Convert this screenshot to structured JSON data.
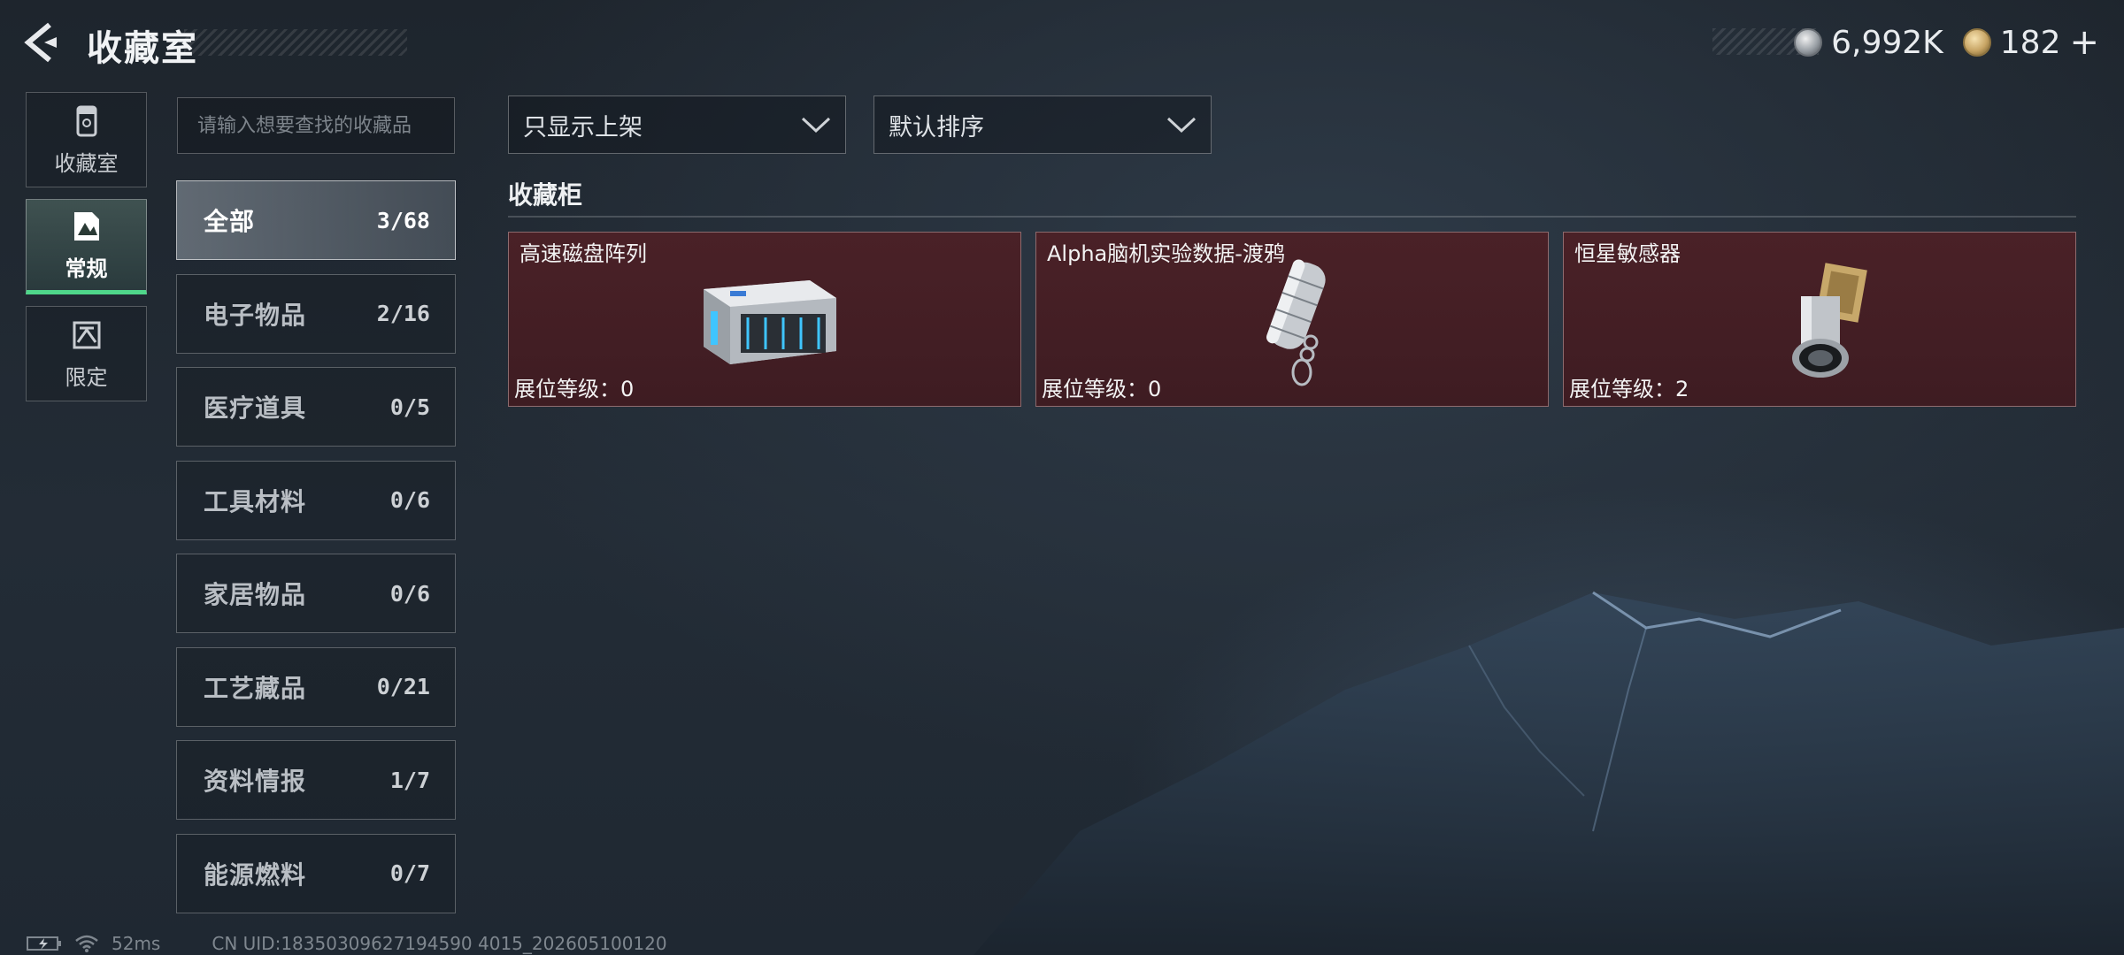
{
  "header": {
    "title": "收藏室",
    "currencies": [
      {
        "icon": "silver-coin-icon",
        "value": "6,992K"
      },
      {
        "icon": "gold-coin-icon",
        "value": "182"
      }
    ],
    "plus_label": "+"
  },
  "nav": {
    "items": [
      {
        "label": "收藏室",
        "icon": "collection-room-icon",
        "active": false
      },
      {
        "label": "常规",
        "icon": "regular-icon",
        "active": true
      },
      {
        "label": "限定",
        "icon": "limited-icon",
        "active": false
      }
    ]
  },
  "search": {
    "placeholder": "请输入想要查找的收藏品",
    "value": ""
  },
  "categories": [
    {
      "label": "全部",
      "count": "3/68",
      "active": true
    },
    {
      "label": "电子物品",
      "count": "2/16"
    },
    {
      "label": "医疗道具",
      "count": "0/5"
    },
    {
      "label": "工具材料",
      "count": "0/6"
    },
    {
      "label": "家居物品",
      "count": "0/6"
    },
    {
      "label": "工艺藏品",
      "count": "0/21"
    },
    {
      "label": "资料情报",
      "count": "1/7"
    },
    {
      "label": "能源燃料",
      "count": "0/7"
    }
  ],
  "filters": {
    "display": "只显示上架",
    "sort": "默认排序"
  },
  "section": {
    "title": "收藏柜"
  },
  "cards": [
    {
      "name": "高速磁盘阵列",
      "level": "展位等级：0",
      "image": "disk-array-icon"
    },
    {
      "name": "Alpha脑机实验数据-渡鸦",
      "level": "展位等级：0",
      "image": "data-drive-keychain-icon"
    },
    {
      "name": "恒星敏感器",
      "level": "展位等级：2",
      "image": "star-sensor-icon"
    }
  ],
  "status": {
    "ping": "52ms",
    "uid": "CN UID:18350309627194590 4015_202605100120"
  },
  "colors": {
    "accent_green": "#4fd68a",
    "card_bg": "#44202a"
  }
}
